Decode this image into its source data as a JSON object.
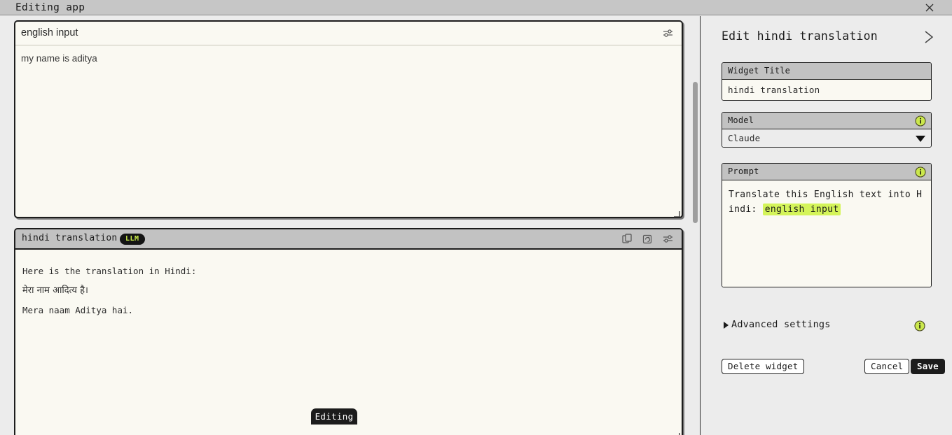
{
  "titlebar": {
    "title": "Editing app",
    "close_icon": "close-icon"
  },
  "canvas": {
    "widgets": [
      {
        "id": "english-input",
        "title": "english input",
        "content": "my name is aditya",
        "icons": [
          "sliders-icon"
        ]
      },
      {
        "id": "hindi-translation",
        "title": "hindi translation",
        "badge": "LLM",
        "content_lines": [
          "Here is the translation in Hindi:",
          "मेरा नाम आदित्य है।",
          "Mera naam Aditya hai."
        ],
        "icons": [
          "copy-icon",
          "regenerate-icon",
          "sliders-icon"
        ]
      }
    ],
    "editing_tab_label": "Editing"
  },
  "panel": {
    "title": "Edit hindi translation",
    "collapse_icon": "chevron-right-icon",
    "widget_title": {
      "label": "Widget Title",
      "value": "hindi translation"
    },
    "model": {
      "label": "Model",
      "value": "Claude",
      "info_icon": "info-icon",
      "caret_icon": "chevron-down-icon"
    },
    "prompt": {
      "label": "Prompt",
      "info_icon": "info-icon",
      "text_before": "Translate this English text into Hindi: ",
      "pill": "english input"
    },
    "advanced_settings": {
      "label": "Advanced settings",
      "expanded": false,
      "info_icon": "info-icon"
    },
    "buttons": {
      "delete": "Delete widget",
      "cancel": "Cancel",
      "save": "Save"
    }
  },
  "colors": {
    "accent_green": "#d4f45a",
    "badge_text_green": "#cdf04b",
    "panel_bg": "#ececec",
    "widget_bg": "#faf9f2",
    "header_gray": "#c2c2c2",
    "dark": "#1c1c1c"
  }
}
